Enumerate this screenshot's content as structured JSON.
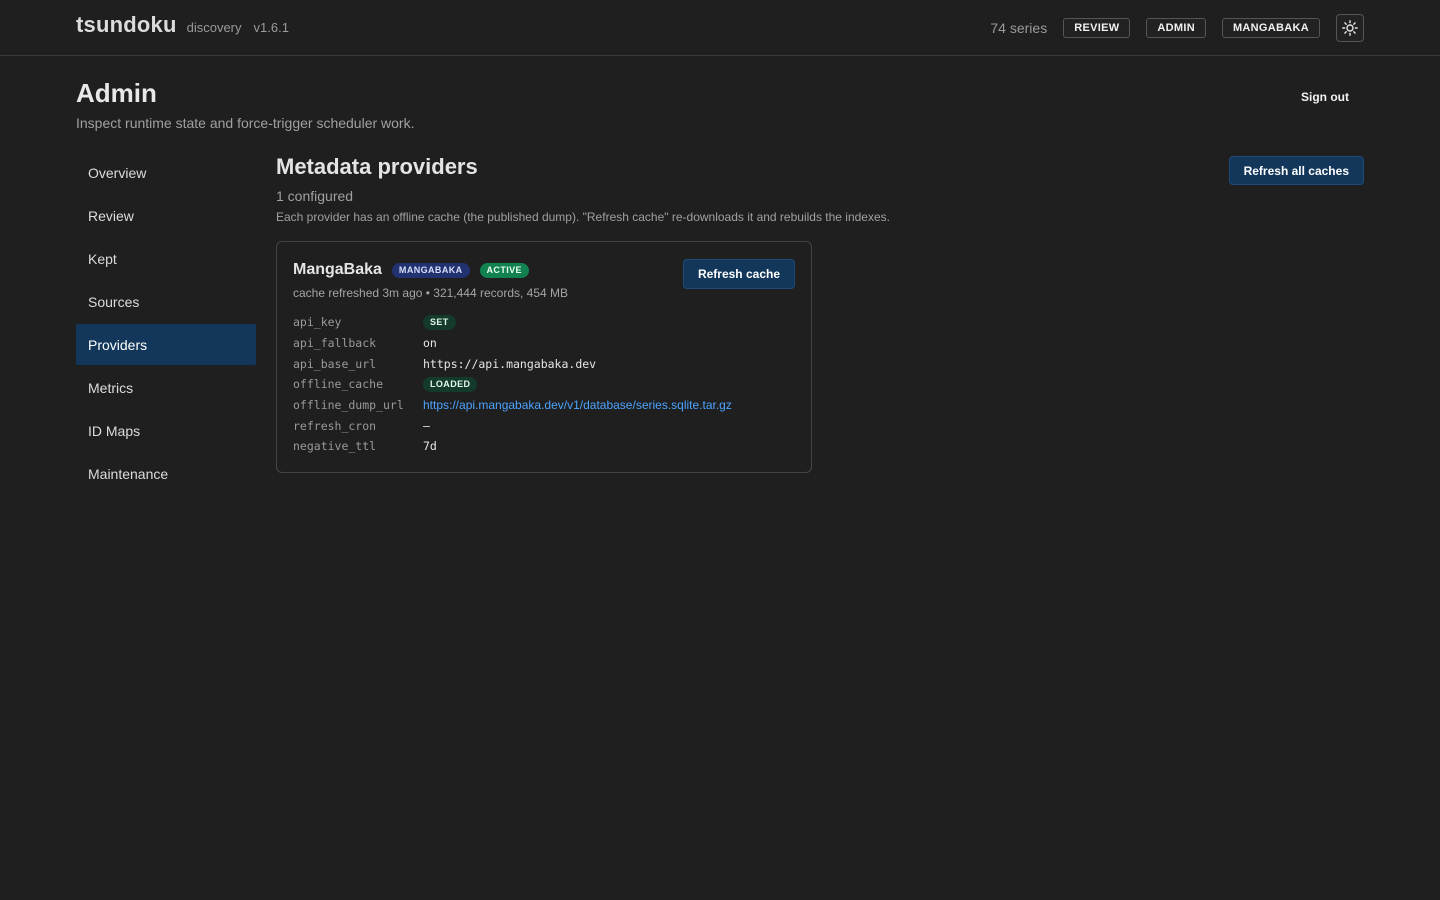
{
  "app": {
    "name": "tsundoku",
    "subtitle": "discovery",
    "version": "v1.6.1"
  },
  "topbar": {
    "series_count": "74 series",
    "buttons": [
      "REVIEW",
      "ADMIN",
      "MANGABAKA"
    ],
    "theme_icon": "sun-icon"
  },
  "header": {
    "title": "Admin",
    "subtitle": "Inspect runtime state and force-trigger scheduler work.",
    "signout_label": "Sign out"
  },
  "sidebar": {
    "items": [
      {
        "label": "Overview",
        "active": false
      },
      {
        "label": "Review",
        "active": false
      },
      {
        "label": "Kept",
        "active": false
      },
      {
        "label": "Sources",
        "active": false
      },
      {
        "label": "Providers",
        "active": true
      },
      {
        "label": "Metrics",
        "active": false
      },
      {
        "label": "ID Maps",
        "active": false
      },
      {
        "label": "Maintenance",
        "active": false
      }
    ]
  },
  "main": {
    "title": "Metadata providers",
    "configured": "1 configured",
    "description": "Each provider has an offline cache (the published dump). \"Refresh cache\" re-downloads it and rebuilds the indexes.",
    "refresh_all_label": "Refresh all caches",
    "provider": {
      "name": "MangaBaka",
      "badge_provider": "MANGABAKA",
      "badge_status": "ACTIVE",
      "refresh_label": "Refresh cache",
      "meta": "cache refreshed 3m ago  • 321,444 records, 454 MB",
      "fields": [
        {
          "key": "api_key",
          "value": "SET",
          "type": "pill"
        },
        {
          "key": "api_fallback",
          "value": "on",
          "type": "text"
        },
        {
          "key": "api_base_url",
          "value": "https://api.mangabaka.dev",
          "type": "text"
        },
        {
          "key": "offline_cache",
          "value": "LOADED",
          "type": "pill"
        },
        {
          "key": "offline_dump_url",
          "value": "https://api.mangabaka.dev/v1/database/series.sqlite.tar.gz",
          "type": "link"
        },
        {
          "key": "refresh_cron",
          "value": "—",
          "type": "text"
        },
        {
          "key": "negative_ttl",
          "value": "7d",
          "type": "text"
        }
      ]
    }
  },
  "colors": {
    "background": "#1f1f1f",
    "accent": "#12375a",
    "active_badge": "#11824f",
    "provider_badge": "#22316f",
    "link": "#4da3ff"
  }
}
